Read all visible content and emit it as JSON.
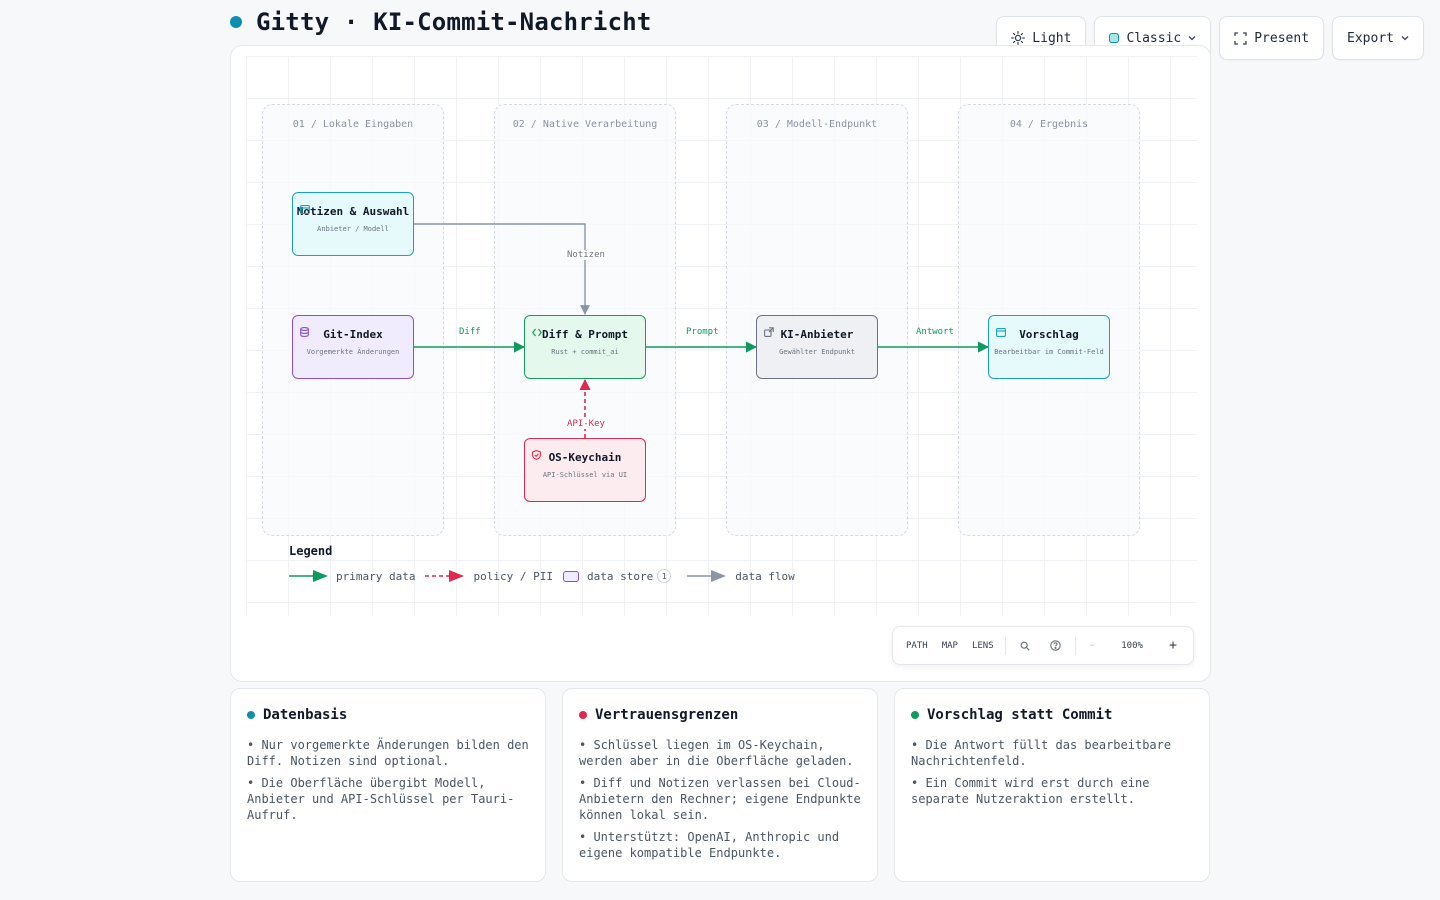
{
  "header": {
    "title": "Gitty · KI-Commit-Nachricht",
    "accent_color": "#0e8fb0"
  },
  "toolbar": {
    "theme_label": "Light",
    "style_label": "Classic",
    "present_label": "Present",
    "export_label": "Export",
    "icons": [
      "sun-icon",
      "chevron-down-icon",
      "fullscreen-icon",
      "chevron-down-icon"
    ]
  },
  "diagram": {
    "lanes": [
      {
        "title": "01 / Lokale Eingaben"
      },
      {
        "title": "02 / Native Verarbeitung"
      },
      {
        "title": "03 / Modell-Endpunkt"
      },
      {
        "title": "04 / Ergebnis"
      }
    ],
    "nodes": {
      "notes": {
        "title": "Notizen & Auswahl",
        "subtitle": "Anbieter / Modell",
        "icon": "window-icon"
      },
      "git_index": {
        "title": "Git-Index",
        "subtitle": "Vorgemerkte Änderungen",
        "icon": "database-icon"
      },
      "diff_prompt": {
        "title": "Diff & Prompt",
        "subtitle": "Rust + commit_ai",
        "icon": "code-icon"
      },
      "provider": {
        "title": "KI-Anbieter",
        "subtitle": "Gewählter Endpunkt",
        "icon": "external-link-icon"
      },
      "suggestion": {
        "title": "Vorschlag",
        "subtitle": "Bearbeitbar im Commit-Feld",
        "icon": "window-icon"
      },
      "keychain": {
        "title": "OS-Keychain",
        "subtitle": "API-Schlüssel via UI",
        "icon": "shield-icon"
      }
    },
    "edges": {
      "diff": "Diff",
      "prompt": "Prompt",
      "answer": "Antwort",
      "notes": "Notizen",
      "api_key": "API-Key"
    },
    "colors": {
      "primary": "#0f9a5e",
      "policy": "#e0294e",
      "flow": "#8a96a8"
    }
  },
  "legend": {
    "title": "Legend",
    "primary": "primary data",
    "policy": "policy / PII",
    "store": "data store",
    "store_count": "1",
    "flow": "data flow"
  },
  "controls": {
    "path": "PATH",
    "map": "MAP",
    "lens": "LENS",
    "minus": "−",
    "zoom": "100%",
    "plus": "+"
  },
  "cards": [
    {
      "title": "Datenbasis",
      "color": "#0e8fb0",
      "items": [
        "• Nur vorgemerkte Änderungen bilden den Diff. Notizen sind optional.",
        "• Die Oberfläche übergibt Modell, Anbieter und API-Schlüssel per Tauri-Aufruf."
      ]
    },
    {
      "title": "Vertrauensgrenzen",
      "color": "#e0294e",
      "items": [
        "• Schlüssel liegen im OS-Keychain, werden aber in die Oberfläche geladen.",
        "• Diff und Notizen verlassen bei Cloud-Anbietern den Rechner; eigene Endpunkte können lokal sein.",
        "• Unterstützt: OpenAI, Anthropic und eigene kompatible Endpunkte."
      ]
    },
    {
      "title": "Vorschlag statt Commit",
      "color": "#0f9a5e",
      "items": [
        "• Die Antwort füllt das bearbeitbare Nachrichtenfeld.",
        "• Ein Commit wird erst durch eine separate Nutzeraktion erstellt."
      ]
    }
  ]
}
